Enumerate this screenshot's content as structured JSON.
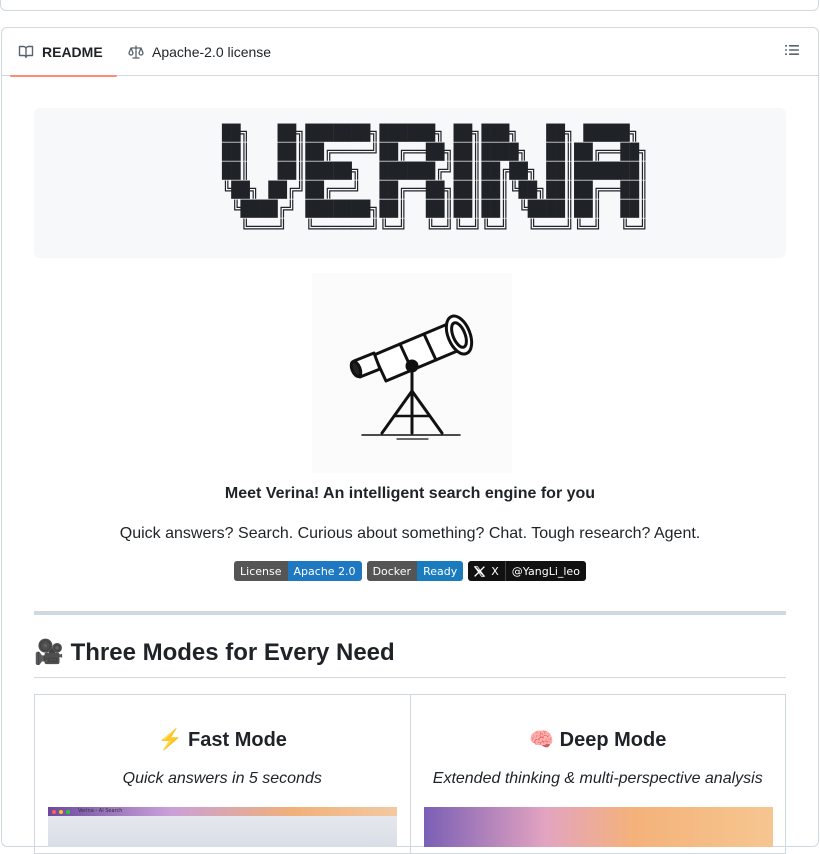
{
  "tabs": {
    "readme_label": "README",
    "license_label": "Apache-2.0 license"
  },
  "ascii_logo": "██╗   ██╗███████╗██████╗ ██╗███╗   ██╗ █████╗ \n██║   ██║██╔════╝██╔══██╗██║████╗  ██║██╔══██╗\n██║   ██║█████╗  ██████╔╝██║██╔██╗ ██║███████║\n╚██╗ ██╔╝██╔══╝  ██╔══██╗██║██║╚██╗██║██╔══██║\n ╚████╔╝ ███████╗██║  ██║██║██║ ╚████║██║  ██║\n  ╚═══╝  ╚══════╝╚═╝  ╚═╝╚═╝╚═╝  ╚═══╝╚═╝  ╚═╝",
  "tagline": "Meet Verina! An intelligent search engine for you",
  "subtitle": "Quick answers? Search. Curious about something? Chat. Tough research? Agent.",
  "badges": {
    "license_left": "License",
    "license_right": "Apache 2.0",
    "docker_left": "Docker",
    "docker_right": "Ready",
    "x_left": "X",
    "x_right": "@YangLi_leo"
  },
  "section_heading": {
    "emoji": "🎥",
    "text": "Three Modes for Every Need"
  },
  "modes": [
    {
      "emoji": "⚡",
      "title": "Fast Mode",
      "description": "Quick answers in 5 seconds",
      "screenshot_tab": "Verina - AI Search"
    },
    {
      "emoji": "🧠",
      "title": "Deep Mode",
      "description": "Extended thinking & multi-perspective analysis"
    }
  ],
  "colors": {
    "active_tab_underline": "#fd8c73",
    "badge_blue": "#1e78c2",
    "border": "#d1d9e0"
  }
}
